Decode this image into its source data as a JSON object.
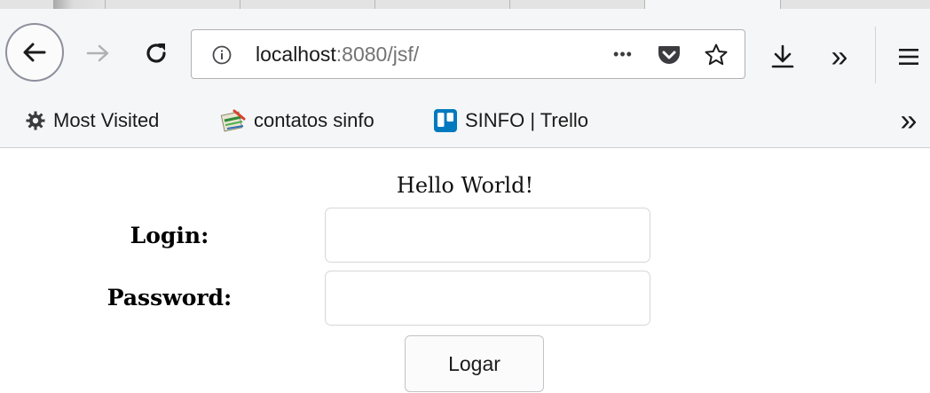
{
  "browser": {
    "url_host": "localhost",
    "url_rest": ":8080/jsf/",
    "page_actions_glyph": "•••",
    "icons": {
      "back": "back-arrow-icon",
      "forward": "forward-arrow-icon",
      "reload": "reload-icon",
      "site_info": "info-icon",
      "pocket": "pocket-icon",
      "bookmark": "star-icon",
      "downloads": "download-icon",
      "overflow": "chevron-double-right-icon",
      "menu": "hamburger-menu-icon"
    },
    "overflow_glyph": "»",
    "menu_glyph": "☰",
    "bookmarks_overflow_glyph": "»"
  },
  "bookmarks": {
    "items": [
      {
        "label": "Most Visited",
        "icon": "gear-icon"
      },
      {
        "label": "contatos sinfo",
        "icon": "spreadsheet-icon"
      },
      {
        "label": "SINFO | Trello",
        "icon": "trello-icon"
      }
    ]
  },
  "page": {
    "heading": "Hello World!",
    "login_label": "Login:",
    "login_value": "",
    "password_label": "Password:",
    "password_value": "",
    "submit_label": "Logar"
  },
  "colors": {
    "chrome_bg": "#f5f6f7",
    "trello_blue": "#0079bf",
    "pocket_gray": "#5b5b66"
  }
}
